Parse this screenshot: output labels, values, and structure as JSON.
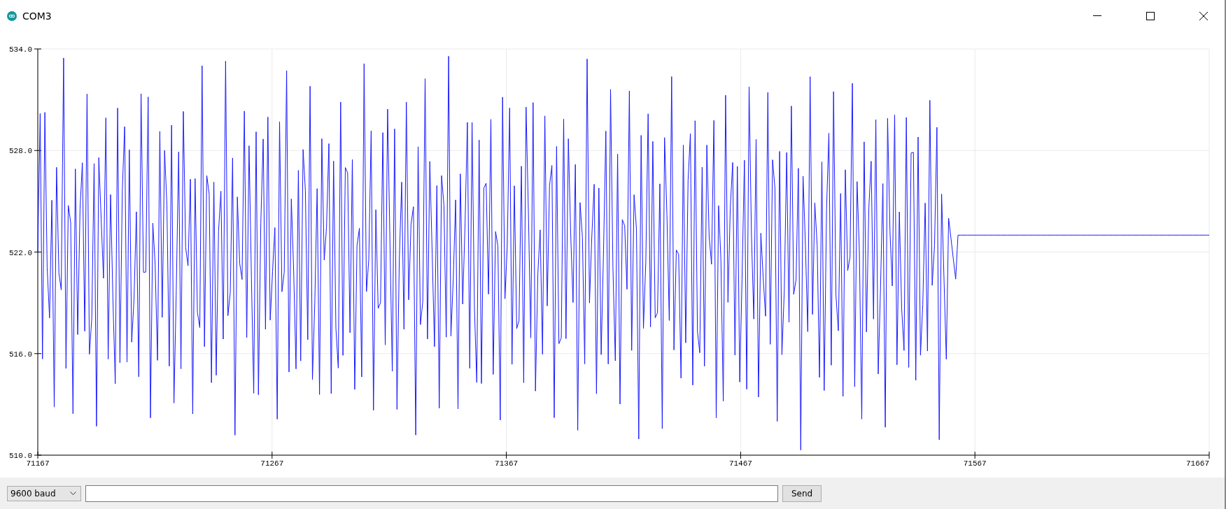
{
  "window": {
    "title": "COM3"
  },
  "plot": {
    "y_labels": [
      "534.0",
      "528.0",
      "522.0",
      "516.0",
      "510.0"
    ],
    "x_labels": [
      "71167",
      "71267",
      "71367",
      "71467",
      "71567",
      "71667"
    ]
  },
  "controls": {
    "baud_rate": "9600 baud",
    "send_button": "Send"
  }
}
